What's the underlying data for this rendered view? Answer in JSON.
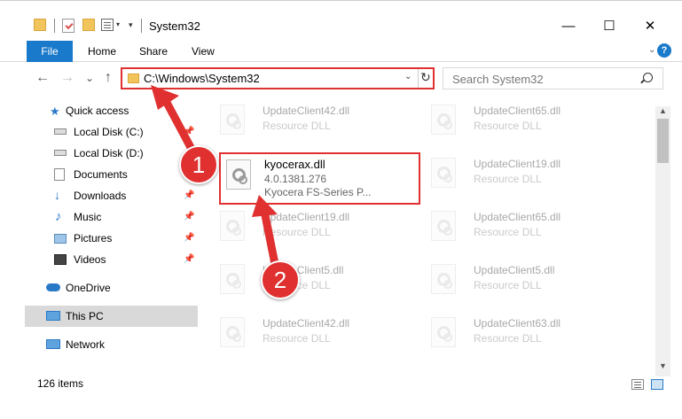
{
  "window": {
    "title": "System32",
    "minimize_glyph": "—",
    "maximize_glyph": "☐",
    "close_glyph": "✕"
  },
  "ribbon": {
    "tabs": [
      "File",
      "Home",
      "Share",
      "View"
    ],
    "help_glyph": "?"
  },
  "nav": {
    "back_glyph": "←",
    "forward_glyph": "→",
    "recent_glyph": "⌄",
    "up_glyph": "↑",
    "address": "C:\\Windows\\System32",
    "search_placeholder": "Search System32"
  },
  "sidebar": {
    "items": [
      {
        "label": "Quick access",
        "icon": "star-icon"
      },
      {
        "label": "Local Disk (C:)",
        "icon": "drive-icon",
        "pinned": true
      },
      {
        "label": "Local Disk (D:)",
        "icon": "drive-icon"
      },
      {
        "label": "Documents",
        "icon": "documents-icon",
        "pinned": true
      },
      {
        "label": "Downloads",
        "icon": "download-icon",
        "pinned": true
      },
      {
        "label": "Music",
        "icon": "music-icon",
        "pinned": true
      },
      {
        "label": "Pictures",
        "icon": "pictures-icon",
        "pinned": true
      },
      {
        "label": "Videos",
        "icon": "videos-icon",
        "pinned": true
      },
      {
        "label": "OneDrive",
        "icon": "cloud-icon"
      },
      {
        "label": "This PC",
        "icon": "computer-icon",
        "selected": true
      },
      {
        "label": "Network",
        "icon": "network-icon"
      }
    ]
  },
  "files": {
    "left": [
      {
        "name": "UpdateClient42.dll",
        "type": "Resource DLL"
      },
      {
        "name": "UpdateClient19.dll",
        "type": "Resource DLL"
      },
      {
        "name": "UpdateClient5.dll",
        "type": "Resource DLL"
      },
      {
        "name": "UpdateClient42.dll",
        "type": "Resource DLL"
      }
    ],
    "right": [
      {
        "name": "UpdateClient65.dll",
        "type": "Resource DLL"
      },
      {
        "name": "UpdateClient19.dll",
        "type": "Resource DLL"
      },
      {
        "name": "UpdateClient65.dll",
        "type": "Resource DLL"
      },
      {
        "name": "UpdateClient5.dll",
        "type": "Resource DLL"
      },
      {
        "name": "UpdateClient63.dll",
        "type": "Resource DLL"
      }
    ],
    "highlighted": {
      "name": "kyocerax.dll",
      "version": "4.0.1381.276",
      "description": "Kyocera FS-Series P..."
    }
  },
  "status": {
    "item_count": "126 items"
  },
  "annotations": {
    "step1": "1",
    "step2": "2",
    "color": "#e03030"
  }
}
